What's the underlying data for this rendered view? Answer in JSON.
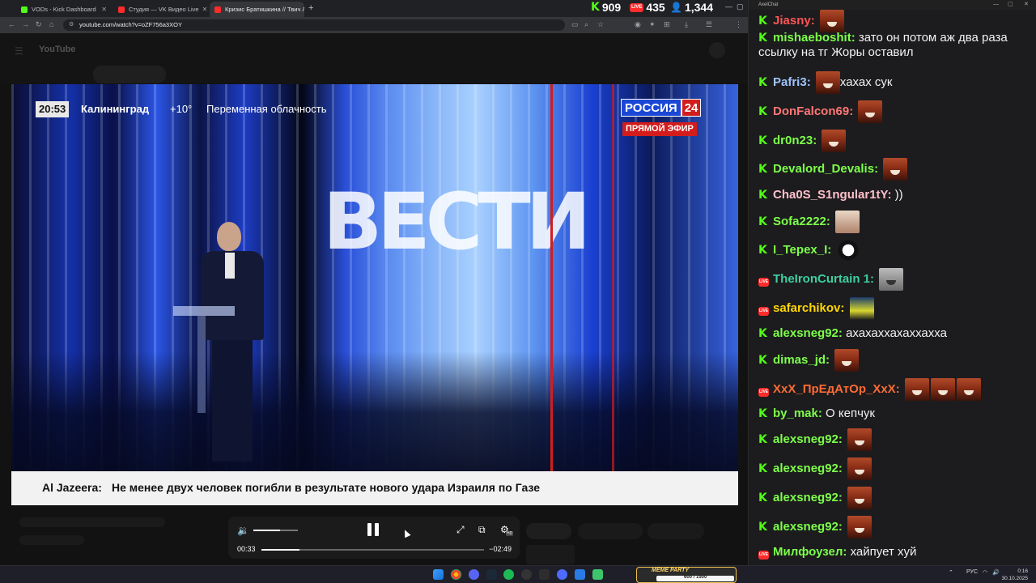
{
  "browser": {
    "tabs": [
      {
        "label": "VODs - Kick Dashboard",
        "color": "#53fc18"
      },
      {
        "label": "Студия — VK Видео Live",
        "color": "#ff2c2c"
      },
      {
        "label": "Кризис Братишкина // Твич Л",
        "color": "#ff2c2c"
      }
    ],
    "new_tab": "+",
    "url": "youtube.com/watch?v=oZF756a3XOY",
    "stats": {
      "kick_viewers": "909",
      "vk_viewers": "435",
      "total_viewers": "1,344",
      "vk_badge": "LIVE"
    }
  },
  "youtube": {
    "logo": "YouTube"
  },
  "video": {
    "time": "20:53",
    "city": "Калининград",
    "temp": "+10°",
    "weather": "Переменная облачность",
    "channel_name": "РОССИЯ",
    "channel_num": "24",
    "live_label": "ПРЯМОЙ ЭФИР",
    "ticker_source": "Al Jazeera:",
    "ticker_text": "Не менее двух человек погибли в результате нового удара Израиля по Газе"
  },
  "player": {
    "current_time": "00:33",
    "remaining_time": "−02:49",
    "progress": 0.17,
    "volume": 0.6,
    "quality_badge": "HD"
  },
  "chat": {
    "window_title": "AxelChat",
    "messages": [
      {
        "platform": "kick",
        "nick": "Jiasny",
        "color": "#ff5555",
        "text": "",
        "emotes": 1
      },
      {
        "platform": "kick",
        "nick": "mishaeboshit",
        "color": "#7dff4a",
        "text": "зато он потом аж два раза ссылку на тг Жоры оставил",
        "emotes": 0
      },
      {
        "platform": "kick",
        "nick": "Pafri3",
        "color": "#9fc5ff",
        "text": "хахах сук",
        "emotes": 1
      },
      {
        "platform": "kick",
        "nick": "DonFalcon69",
        "color": "#ff7777",
        "text": "",
        "emotes": 1
      },
      {
        "platform": "kick",
        "nick": "dr0n23",
        "color": "#7dff4a",
        "text": "",
        "emotes": 1
      },
      {
        "platform": "kick",
        "nick": "Devalord_Devalis",
        "color": "#7dff4a",
        "text": "",
        "emotes": 1
      },
      {
        "platform": "kick",
        "nick": "Cha0S_S1ngular1tY",
        "color": "#ffc0cb",
        "text": "))",
        "emotes": 0
      },
      {
        "platform": "kick",
        "nick": "Sofa2222",
        "color": "#7dff4a",
        "text": "",
        "emotes": 1
      },
      {
        "platform": "kick",
        "nick": "I_Tepex_I",
        "color": "#7dff4a",
        "text": "",
        "emotes": 1
      },
      {
        "platform": "vk",
        "nick": "TheIronCurtain 1",
        "color": "#3ccfa0",
        "text": "",
        "emotes": 1
      },
      {
        "platform": "vk",
        "nick": "safarchikov",
        "color": "#ffd700",
        "text": "",
        "emotes": 1
      },
      {
        "platform": "kick",
        "nick": "alexsneg92",
        "color": "#7dff4a",
        "text": "ахахаххахаххахха",
        "emotes": 0
      },
      {
        "platform": "kick",
        "nick": "dimas_jd",
        "color": "#7dff4a",
        "text": "",
        "emotes": 1
      },
      {
        "platform": "vk",
        "nick": "XxX_ПрЕдАтОр_XxX",
        "color": "#ff6b35",
        "text": "",
        "emotes": 3
      },
      {
        "platform": "kick",
        "nick": "by_mak",
        "color": "#7dff4a",
        "text": "О кепчук",
        "emotes": 0
      },
      {
        "platform": "kick",
        "nick": "alexsneg92",
        "color": "#7dff4a",
        "text": "",
        "emotes": 1
      },
      {
        "platform": "kick",
        "nick": "alexsneg92",
        "color": "#7dff4a",
        "text": "",
        "emotes": 1
      },
      {
        "platform": "kick",
        "nick": "alexsneg92",
        "color": "#7dff4a",
        "text": "",
        "emotes": 1
      },
      {
        "platform": "kick",
        "nick": "alexsneg92",
        "color": "#7dff4a",
        "text": "",
        "emotes": 1
      },
      {
        "platform": "vk",
        "nick": "Милфоузел",
        "color": "#7dff4a",
        "text": "хайпует хуй",
        "emotes": 0
      }
    ]
  },
  "taskbar": {
    "widget_label": "MEME PARTY",
    "widget_count": "600 / 1500",
    "lang": "РУС",
    "time": "0:16",
    "date": "30.10.2025"
  }
}
